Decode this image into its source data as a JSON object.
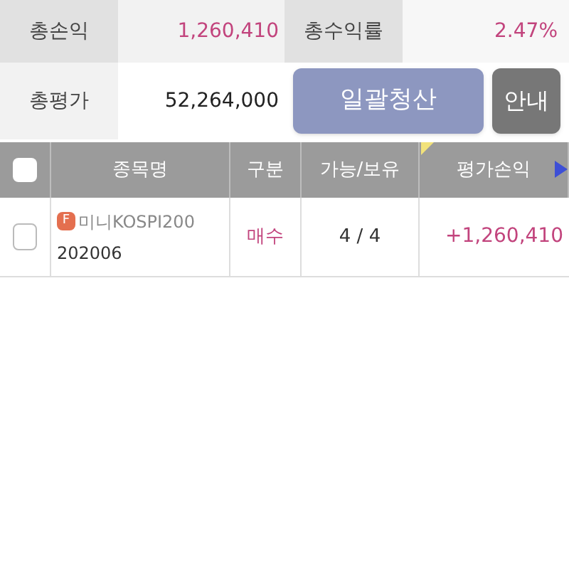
{
  "summary": [
    {
      "label": "총손익",
      "value": "1,260,410"
    },
    {
      "label": "총수익률",
      "value": "2.47%"
    },
    {
      "label": "총평가",
      "value": "52,264,000"
    }
  ],
  "buttons": [
    {
      "label": "일괄청산",
      "kind": "primary"
    },
    {
      "label": "안내",
      "kind": "secondary"
    }
  ],
  "table": {
    "select_all_checked": false,
    "columns": [
      "종목명",
      "구분",
      "가능/보유",
      "평가손익"
    ],
    "rows": [
      {
        "checked": false,
        "badge": "F",
        "name": "미니KOSPI200",
        "code": "202006",
        "side": "매수",
        "qty": "4 / 4",
        "pnl": "+1,260,410"
      }
    ]
  }
}
